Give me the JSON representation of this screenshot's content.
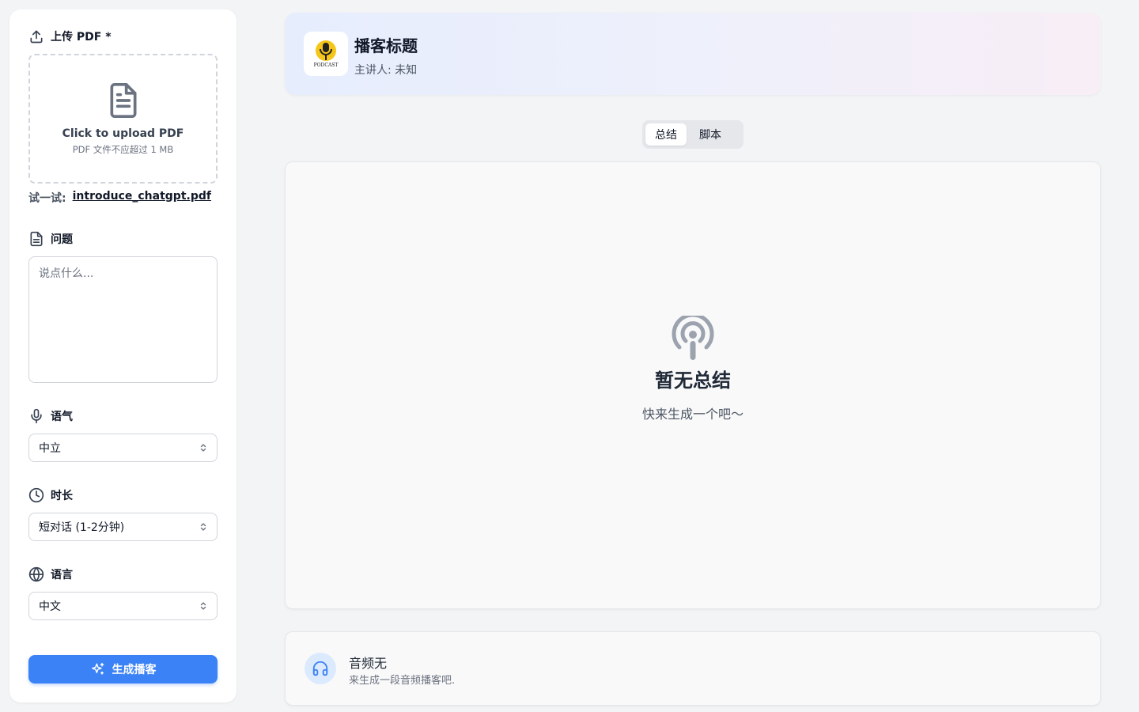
{
  "sidebar": {
    "upload": {
      "label": "上传 PDF *",
      "box_title": "Click to upload PDF",
      "box_hint": "PDF 文件不应超过 1 MB",
      "try_prefix": "试一试:",
      "try_link": "introduce_chatgpt.pdf"
    },
    "question": {
      "label": "问题",
      "placeholder": "说点什么..."
    },
    "tone": {
      "label": "语气",
      "value": "中立"
    },
    "duration": {
      "label": "时长",
      "value": "短对话 (1-2分钟)"
    },
    "language": {
      "label": "语言",
      "value": "中文"
    },
    "generate_button": "生成播客"
  },
  "header": {
    "title": "播客标题",
    "host": "主讲人: 未知",
    "logo_text": "PODCAST"
  },
  "tabs": [
    {
      "label": "总结",
      "active": true
    },
    {
      "label": "脚本",
      "active": false
    }
  ],
  "content": {
    "empty_title": "暂无总结",
    "empty_sub": "快来生成一个吧～"
  },
  "audio": {
    "title": "音频无",
    "subtitle": "来生成一段音频播客吧."
  },
  "colors": {
    "primary": "#3b82f6",
    "icon_gray": "#9ca3af"
  }
}
